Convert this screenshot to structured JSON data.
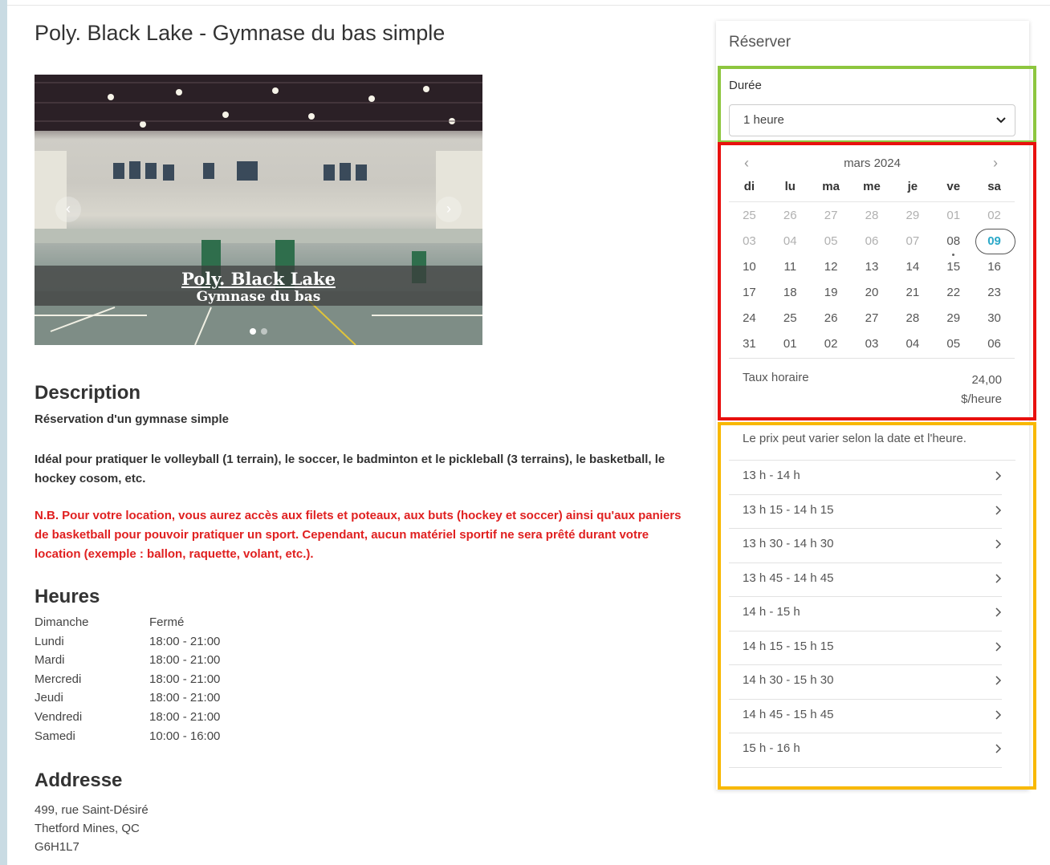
{
  "facility": {
    "title": "Poly. Black Lake - Gymnase du bas simple"
  },
  "carousel": {
    "caption_line1": "Poly. Black Lake",
    "caption_line2": "Gymnase du bas",
    "prev_label": "‹",
    "next_label": "›"
  },
  "description": {
    "heading": "Description",
    "subtitle": "Réservation d'un gymnase simple",
    "text": "Idéal pour pratiquer le volleyball (1 terrain), le soccer, le badminton et le pickleball (3 terrains), le basketball, le hockey cosom, etc.",
    "warning": "N.B. Pour votre location, vous aurez accès aux filets et poteaux, aux buts (hockey et soccer) ainsi qu'aux paniers de basketball pour pouvoir pratiquer un sport. Cependant, aucun matériel sportif ne sera prêté durant votre location (exemple : ballon, raquette, volant, etc.)."
  },
  "hours": {
    "heading": "Heures",
    "rows": [
      {
        "day": "Dimanche",
        "time": "Fermé"
      },
      {
        "day": "Lundi",
        "time": "18:00 - 21:00"
      },
      {
        "day": "Mardi",
        "time": "18:00 - 21:00"
      },
      {
        "day": "Mercredi",
        "time": "18:00 - 21:00"
      },
      {
        "day": "Jeudi",
        "time": "18:00 - 21:00"
      },
      {
        "day": "Vendredi",
        "time": "18:00 - 21:00"
      },
      {
        "day": "Samedi",
        "time": "10:00 - 16:00"
      }
    ]
  },
  "address": {
    "heading": "Addresse",
    "line1": "499, rue Saint-Désiré",
    "line2": "Thetford Mines, QC",
    "line3": "G6H1L7"
  },
  "reservation": {
    "title": "Réserver",
    "duration_label": "Durée",
    "duration_value": "1 heure",
    "calendar": {
      "month": "mars 2024",
      "prev": "‹",
      "next": "›",
      "weekdays": [
        "di",
        "lu",
        "ma",
        "me",
        "je",
        "ve",
        "sa"
      ],
      "weeks": [
        [
          {
            "d": "25",
            "s": "off"
          },
          {
            "d": "26",
            "s": "off"
          },
          {
            "d": "27",
            "s": "off"
          },
          {
            "d": "28",
            "s": "off"
          },
          {
            "d": "29",
            "s": "off"
          },
          {
            "d": "01",
            "s": "off"
          },
          {
            "d": "02",
            "s": "off"
          }
        ],
        [
          {
            "d": "03",
            "s": "off"
          },
          {
            "d": "04",
            "s": "off"
          },
          {
            "d": "05",
            "s": "off"
          },
          {
            "d": "06",
            "s": "off"
          },
          {
            "d": "07",
            "s": "off"
          },
          {
            "d": "08",
            "s": "on",
            "dot": true
          },
          {
            "d": "09",
            "s": "today"
          }
        ],
        [
          {
            "d": "10",
            "s": "on"
          },
          {
            "d": "11",
            "s": "on"
          },
          {
            "d": "12",
            "s": "on"
          },
          {
            "d": "13",
            "s": "on"
          },
          {
            "d": "14",
            "s": "on"
          },
          {
            "d": "15",
            "s": "on"
          },
          {
            "d": "16",
            "s": "on"
          }
        ],
        [
          {
            "d": "17",
            "s": "on"
          },
          {
            "d": "18",
            "s": "on"
          },
          {
            "d": "19",
            "s": "on"
          },
          {
            "d": "20",
            "s": "on"
          },
          {
            "d": "21",
            "s": "on"
          },
          {
            "d": "22",
            "s": "on"
          },
          {
            "d": "23",
            "s": "on"
          }
        ],
        [
          {
            "d": "24",
            "s": "on"
          },
          {
            "d": "25",
            "s": "on"
          },
          {
            "d": "26",
            "s": "on"
          },
          {
            "d": "27",
            "s": "on"
          },
          {
            "d": "28",
            "s": "on"
          },
          {
            "d": "29",
            "s": "on"
          },
          {
            "d": "30",
            "s": "on"
          }
        ],
        [
          {
            "d": "31",
            "s": "on"
          },
          {
            "d": "01",
            "s": "on"
          },
          {
            "d": "02",
            "s": "on"
          },
          {
            "d": "03",
            "s": "on"
          },
          {
            "d": "04",
            "s": "on"
          },
          {
            "d": "05",
            "s": "on"
          },
          {
            "d": "06",
            "s": "on"
          }
        ]
      ]
    },
    "rate_label": "Taux horaire",
    "rate_amount": "24,00",
    "rate_unit": "$/heure",
    "price_note": "Le prix peut varier selon la date et l'heure.",
    "slots": [
      "13 h - 14 h",
      "13 h 15 - 14 h 15",
      "13 h 30 - 14 h 30",
      "13 h 45 - 14 h 45",
      "14 h - 15 h",
      "14 h 15 - 15 h 15",
      "14 h 30 - 15 h 30",
      "14 h 45 - 15 h 45",
      "15 h - 16 h"
    ]
  },
  "colors": {
    "highlight_green": "#8dc63f",
    "highlight_red": "#e8100e",
    "highlight_yellow": "#f8b800",
    "warning_text": "#e02020",
    "selected_day": "#2aa8c8"
  }
}
